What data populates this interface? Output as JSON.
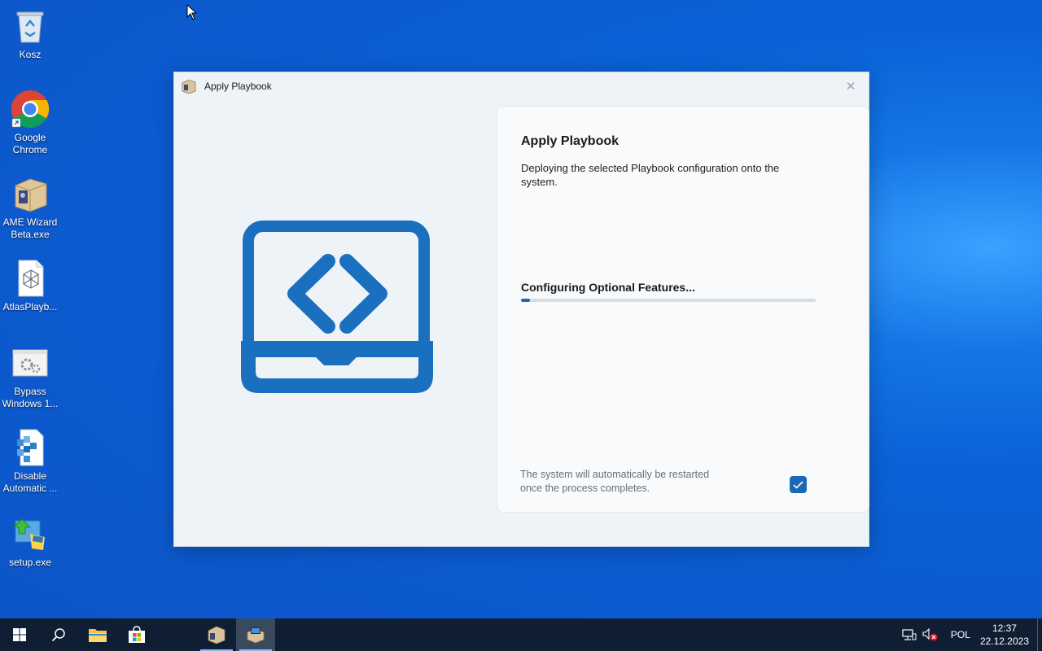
{
  "desktop": {
    "icons": [
      {
        "name": "recycle-bin",
        "label": "Kosz"
      },
      {
        "name": "google-chrome",
        "label": "Google\nChrome"
      },
      {
        "name": "ame-wizard",
        "label": "AME Wizard\nBeta.exe"
      },
      {
        "name": "atlas-playbook",
        "label": "AtlasPlayb..."
      },
      {
        "name": "bypass-windows",
        "label": "Bypass\nWindows 1..."
      },
      {
        "name": "disable-automatic",
        "label": "Disable\nAutomatic ..."
      },
      {
        "name": "setup-exe",
        "label": "setup.exe"
      }
    ]
  },
  "window": {
    "title": "Apply Playbook",
    "close_glyph": "✕",
    "panel": {
      "heading": "Apply Playbook",
      "description": "Deploying the selected Playbook configuration onto the system.",
      "status": "Configuring Optional Features...",
      "progress_fraction": 0.03,
      "restart_note": "The system will automatically be restarted once the process completes.",
      "restart_checked": true
    }
  },
  "colors": {
    "accent": "#1a69b4",
    "art_blue": "#1a6fbf",
    "taskbar": "#0f1e33"
  },
  "taskbar": {
    "items": [
      "start-button",
      "search-button",
      "file-explorer",
      "microsoft-store",
      "ame-wizard",
      "playbook-app"
    ],
    "tray": {
      "language": "POL",
      "time": "12:37",
      "date": "22.12.2023"
    }
  }
}
